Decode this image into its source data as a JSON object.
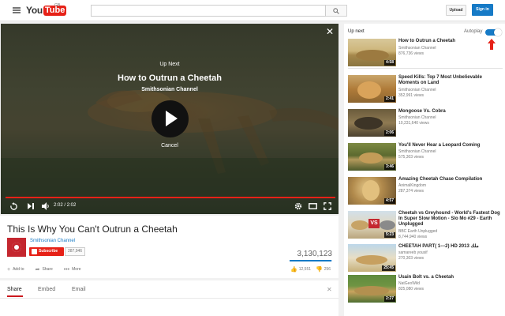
{
  "header": {
    "logo_you": "You",
    "logo_tube": "Tube",
    "logo_region": "GB",
    "search_placeholder": "",
    "upload_label": "Upload",
    "signin_label": "Sign in"
  },
  "player": {
    "upnext_label": "Up Next",
    "upnext_title": "How to Outrun a Cheetah",
    "upnext_channel": "Smithsonian Channel",
    "cancel_label": "Cancel",
    "time": "2:02 / 2:02",
    "progress": 1.0
  },
  "video": {
    "title": "This Is Why You Can't Outrun a Cheetah",
    "channel": "Smithsonian Channel",
    "subscribe_label": "Subscribe",
    "subscriber_count": "287,946",
    "view_count": "3,130,123",
    "like_ratio": 0.98,
    "actions": {
      "add_to": "Add to",
      "share": "Share",
      "more": "More"
    },
    "likes": "12,551",
    "dislikes": "256"
  },
  "share_panel": {
    "tabs": [
      "Share",
      "Embed",
      "Email"
    ],
    "active_tab": "Share"
  },
  "sidebar": {
    "up_next_label": "Up next",
    "autoplay_label": "Autoplay",
    "autoplay_on": true,
    "accent_color": "#167ac6",
    "arrow_color": "#e62117",
    "items": [
      {
        "title": "How to Outrun a Cheetah",
        "channel": "Smithsonian Channel",
        "views": "876,736 views",
        "duration": "4:58"
      },
      {
        "title": "Speed Kills: Top 7 Most Unbelievable Moments on Land",
        "channel": "Smithsonian Channel",
        "views": "352,991 views",
        "duration": "2:41"
      },
      {
        "title": "Mongoose Vs. Cobra",
        "channel": "Smithsonian Channel",
        "views": "10,231,640 views",
        "duration": "2:06"
      },
      {
        "title": "You'll Never Hear a Leopard Coming",
        "channel": "Smithsonian Channel",
        "views": "575,303 views",
        "duration": "3:46"
      },
      {
        "title": "Amazing Cheetah Chase Compilation",
        "channel": "AnimalKingdom",
        "views": "287,374 views",
        "duration": "4:57"
      },
      {
        "title": "Cheetah vs Greyhound - World's Fastest Dog In Super Slow Motion - Slo Mo #29 - Earth Unplugged",
        "channel": "BBC Earth Unplugged",
        "views": "8,744,940 views",
        "duration": "5:23"
      },
      {
        "title": "CHEETAH PART( 1---2) HD 2013 ملك",
        "channel": "samareeb yousif",
        "views": "270,303 views",
        "duration": "25:45"
      },
      {
        "title": "Usain Bolt vs. a Cheetah",
        "channel": "NatGeoWild",
        "views": "825,080 views",
        "duration": "2:27"
      }
    ]
  }
}
